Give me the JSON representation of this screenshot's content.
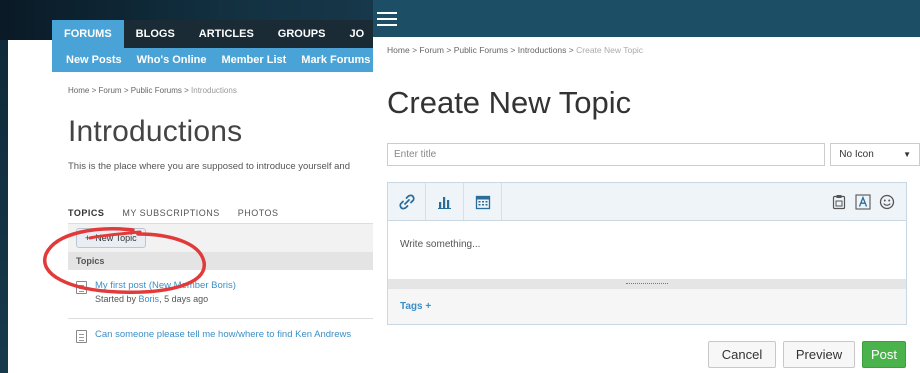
{
  "colors": {
    "accent_blue": "#4aa3d6",
    "nav_dark": "#1a2b35",
    "right_topbar": "#1c4e66",
    "post_green": "#4bb34b",
    "link_blue": "#3a8fc7",
    "annotation_red": "#e23a3a"
  },
  "left": {
    "topnav": [
      "FORUMS",
      "BLOGS",
      "ARTICLES",
      "GROUPS",
      "JO"
    ],
    "subnav": [
      "New Posts",
      "Who's Online",
      "Member List",
      "Mark Forums"
    ],
    "breadcrumb": {
      "items": [
        "Home",
        "Forum",
        "Public Forums"
      ],
      "current": "Introductions",
      "separator": ">"
    },
    "title": "Introductions",
    "description": "This is the place where you are supposed to introduce yourself and",
    "tabs": [
      "TOPICS",
      "MY SUBSCRIPTIONS",
      "PHOTOS"
    ],
    "new_topic_label": "New Topic",
    "topics_header": "Topics",
    "topics": [
      {
        "title": "My first post (New Member Boris)",
        "started_prefix": "Started by",
        "author": "Boris",
        "age": "5 days ago"
      },
      {
        "title": "Can someone please tell me how/where to find Ken Andrews"
      }
    ]
  },
  "right": {
    "breadcrumb": {
      "items": [
        "Home",
        "Forum",
        "Public Forums",
        "Introductions"
      ],
      "current": "Create New Topic",
      "separator": ">"
    },
    "title": "Create New Topic",
    "title_placeholder": "Enter title",
    "icon_select": "No Icon",
    "toolbar_left_icons": [
      "link-icon",
      "chart-icon",
      "calendar-icon"
    ],
    "toolbar_right_icons": [
      "clipboard-icon",
      "text-format-icon",
      "emoji-icon"
    ],
    "editor_placeholder": "Write something...",
    "tags_label": "Tags",
    "tags_plus": "+",
    "buttons": {
      "cancel": "Cancel",
      "preview": "Preview",
      "post": "Post"
    }
  }
}
